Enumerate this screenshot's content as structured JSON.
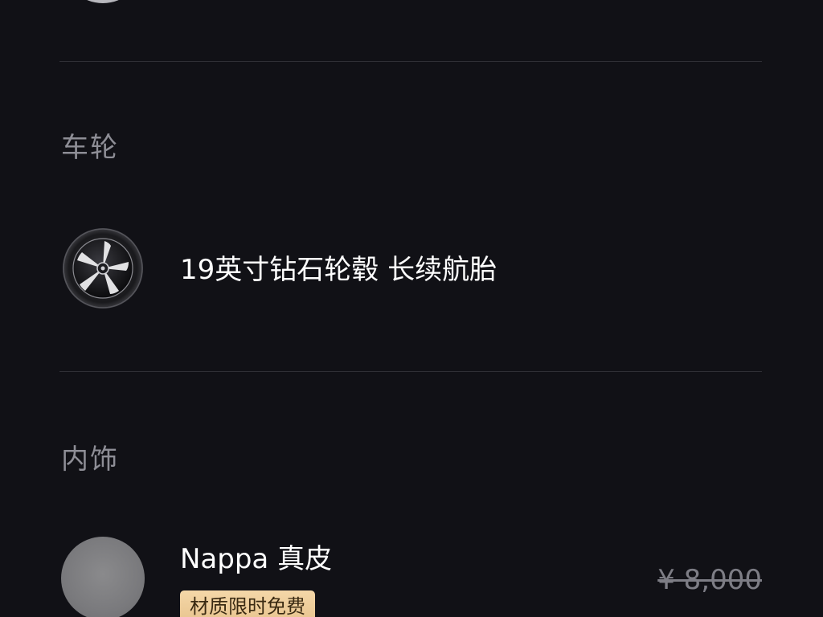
{
  "sections": [
    {
      "title": "车轮",
      "option": {
        "icon": "wheel-icon",
        "label": "19英寸钻石轮毂 长续航胎"
      }
    },
    {
      "title": "内饰",
      "option": {
        "icon": "leather-swatch",
        "label": "Nappa 真皮",
        "badge": "材质限时免费",
        "original_price": "¥ 8,000"
      }
    }
  ],
  "colors": {
    "background": "#111116",
    "section_title": "#8e8e96",
    "divider": "#2f2f35",
    "badge_bg": "#f0d29f",
    "badge_text": "#3a2a12",
    "price_strikethrough": "#7d7d85"
  }
}
